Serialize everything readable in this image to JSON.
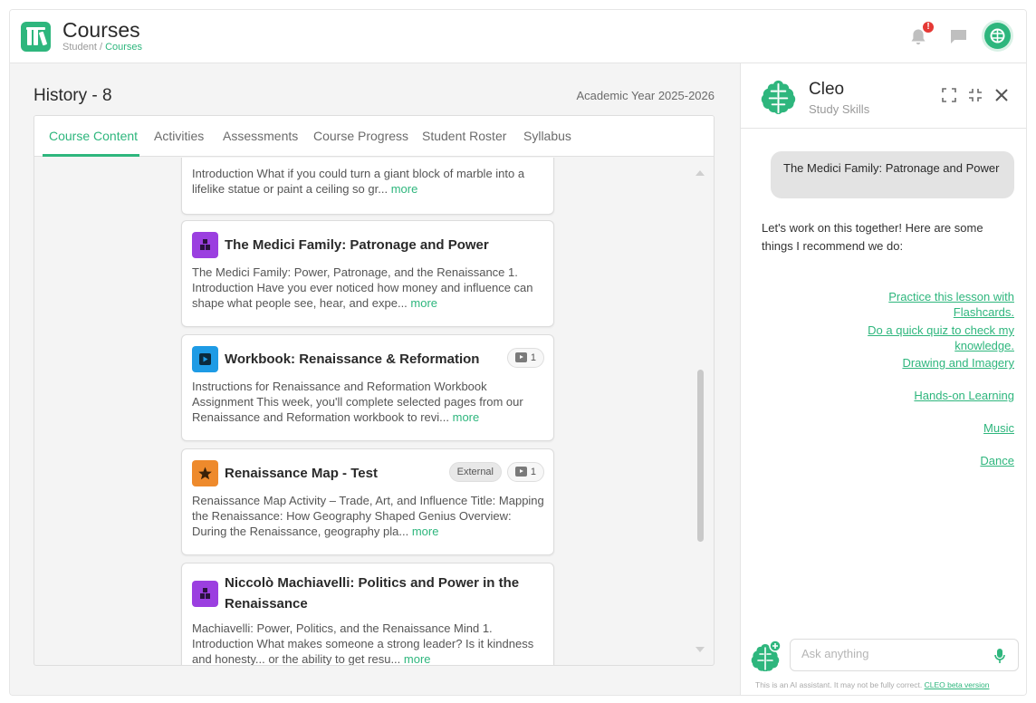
{
  "header": {
    "title": "Courses",
    "breadcrumb": {
      "root": "Student",
      "separator": " / ",
      "current": "Courses"
    },
    "notification_count": "!",
    "colors": {
      "brand": "#2eb67d",
      "badge": "#e53935"
    }
  },
  "course": {
    "title": "History - 8",
    "academic_year": "Academic Year 2025-2026"
  },
  "tabs": [
    {
      "label": "Course Content",
      "active": true
    },
    {
      "label": "Activities"
    },
    {
      "label": "Assessments"
    },
    {
      "label": "Course Progress"
    },
    {
      "label": "Student Roster"
    },
    {
      "label": "Syllabus"
    }
  ],
  "cards": [
    {
      "desc": "Introduction What if you could turn a giant block of marble into a lifelike statue or paint a ceiling so gr...",
      "more": "more"
    },
    {
      "title": "The Medici Family: Patronage and Power",
      "icon": "lesson-icon",
      "desc": "The Medici Family: Power, Patronage, and the Renaissance 1. Introduction Have you ever noticed how money and influence can shape what people see, hear, and expe...",
      "more": "more"
    },
    {
      "title": "Workbook: Renaissance & Reformation",
      "icon": "video-icon",
      "media_count": "1",
      "desc": "Instructions for Renaissance and Reformation Workbook Assignment This week, you'll complete selected pages from our Renaissance and Reformation workbook to revi...",
      "more": "more"
    },
    {
      "title": "Renaissance Map - Test",
      "icon": "star-icon",
      "external_label": "External",
      "media_count": "1",
      "desc": "Renaissance Map Activity – Trade, Art, and Influence Title: Mapping the Renaissance: How Geography Shaped Genius Overview: During the Renaissance, geography pla...",
      "more": "more"
    },
    {
      "title": "Niccolò Machiavelli: Politics and Power in the Renaissance",
      "icon": "lesson-icon",
      "desc": "Machiavelli: Power, Politics, and the Renaissance Mind 1. Introduction What makes someone a strong leader? Is it kindness and honesty... or the ability to get resu...",
      "more": "more"
    }
  ],
  "cleo": {
    "name": "Cleo",
    "subtitle": "Study Skills",
    "user_message": "The Medici Family: Patronage and Power",
    "bot_message": "Let's work on this together! Here are some things I recommend we do:",
    "suggestions": [
      "Practice this lesson with Flashcards.",
      "Do a quick quiz to check my knowledge.",
      "Drawing and Imagery",
      "Hands-on Learning",
      "Music",
      "Dance"
    ],
    "input_placeholder": "Ask anything",
    "disclaimer": "This is an AI assistant. It may not be fully correct.",
    "disclaimer_link": "CLEO beta version"
  }
}
